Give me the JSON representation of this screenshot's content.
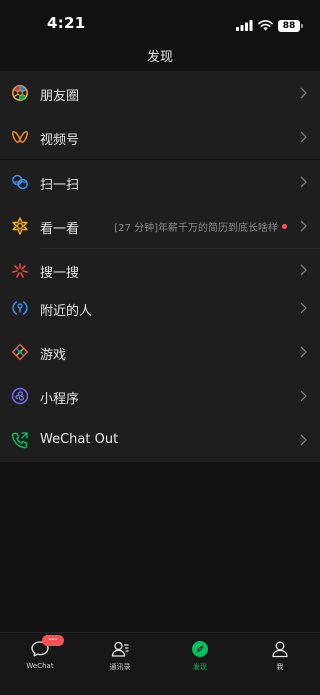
{
  "status_bar": {
    "time": "4:21",
    "battery": "88"
  },
  "nav": {
    "title": "发现"
  },
  "groups": [
    {
      "items": [
        {
          "label": "朋友圈",
          "icon": "moments-icon",
          "color": "#e8b13a"
        }
      ]
    },
    {
      "items": [
        {
          "label": "视频号",
          "icon": "channels-icon",
          "color": "#f08a24"
        }
      ]
    },
    {
      "items": [
        {
          "label": "扫一扫",
          "icon": "scan-icon",
          "color": "#3d8ef0"
        }
      ]
    },
    {
      "items": [
        {
          "label": "看一看",
          "icon": "top-stories-icon",
          "color": "#f5b400",
          "hint": "[27 分钟]年薪千万的简历到底长啥样"
        },
        {
          "label": "搜一搜",
          "icon": "search-icon",
          "color": "#f04848"
        }
      ]
    },
    {
      "items": [
        {
          "label": "附近的人",
          "icon": "people-nearby-icon",
          "color": "#3d8ef0"
        }
      ]
    },
    {
      "items": [
        {
          "label": "游戏",
          "icon": "games-icon",
          "color": "#e85a3c"
        }
      ]
    },
    {
      "items": [
        {
          "label": "小程序",
          "icon": "mini-programs-icon",
          "color": "#7a6ff0"
        }
      ]
    },
    {
      "items": [
        {
          "label": "WeChat Out",
          "icon": "wechat-out-icon",
          "color": "#07c160"
        }
      ]
    }
  ],
  "tabs": [
    {
      "label": "WeChat",
      "icon": "chat-bubble-icon",
      "badge": "···"
    },
    {
      "label": "通讯录",
      "icon": "contacts-icon"
    },
    {
      "label": "发现",
      "icon": "discover-compass-icon",
      "active": true
    },
    {
      "label": "我",
      "icon": "me-icon"
    }
  ],
  "colors": {
    "background": "#111111",
    "row": "#1e1e1e",
    "accent": "#07c160",
    "badge": "#fa5151"
  }
}
